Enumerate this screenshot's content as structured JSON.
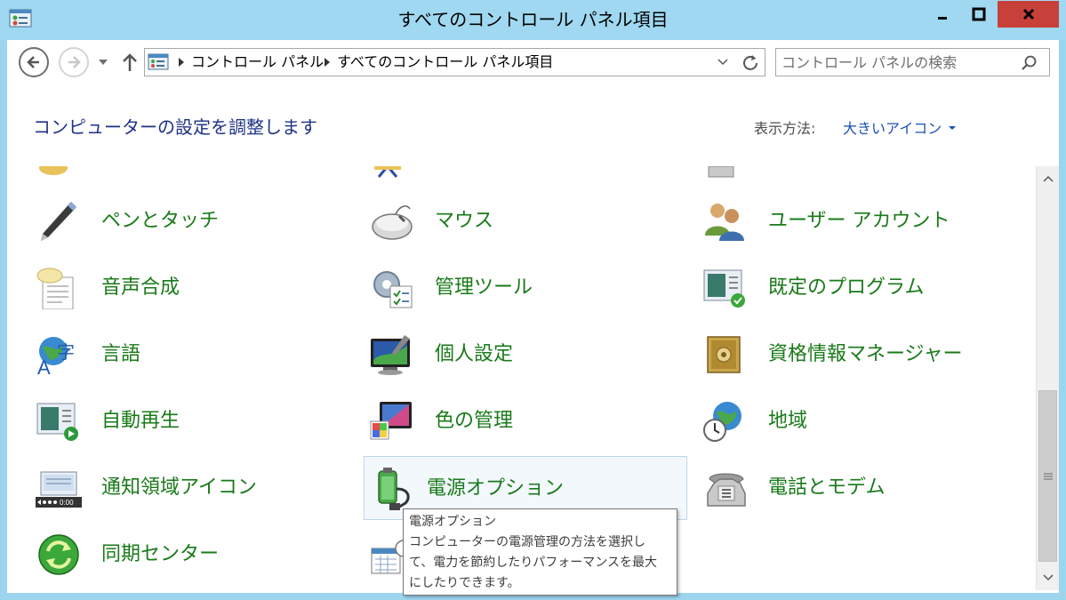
{
  "window": {
    "title": "すべてのコントロール パネル項目"
  },
  "navigation": {
    "breadcrumb": [
      "コントロール パネル",
      "すべてのコントロール パネル項目"
    ],
    "search_placeholder": "コントロール パネルの検索"
  },
  "header": {
    "title": "コンピューターの設定を調整します",
    "view_label": "表示方法:",
    "view_value": "大きいアイコン"
  },
  "items": [
    {
      "label": "ペンとタッチ",
      "icon": "pen-icon"
    },
    {
      "label": "マウス",
      "icon": "mouse-icon"
    },
    {
      "label": "ユーザー アカウント",
      "icon": "users-icon"
    },
    {
      "label": "音声合成",
      "icon": "speech-icon"
    },
    {
      "label": "管理ツール",
      "icon": "admin-tools-icon"
    },
    {
      "label": "既定のプログラム",
      "icon": "default-programs-icon"
    },
    {
      "label": "言語",
      "icon": "language-icon"
    },
    {
      "label": "個人設定",
      "icon": "personalization-icon"
    },
    {
      "label": "資格情報マネージャー",
      "icon": "credential-manager-icon"
    },
    {
      "label": "自動再生",
      "icon": "autoplay-icon"
    },
    {
      "label": "色の管理",
      "icon": "color-management-icon"
    },
    {
      "label": "地域",
      "icon": "region-icon"
    },
    {
      "label": "通知領域アイコン",
      "icon": "notification-area-icon"
    },
    {
      "label": "電源オプション",
      "icon": "power-options-icon"
    },
    {
      "label": "電話とモデム",
      "icon": "phone-modem-icon"
    },
    {
      "label": "同期センター",
      "icon": "sync-center-icon"
    }
  ],
  "tooltip": {
    "title": "電源オプション",
    "lines": [
      "コンピューターの電源管理の方法を選択し",
      "て、電力を節約したりパフォーマンスを最大",
      "にしたりできます。"
    ]
  },
  "colors": {
    "titlebar": "#9fd8f0",
    "link_green": "#197a19",
    "header_blue": "#1e3287",
    "close_red": "#c8403a"
  }
}
